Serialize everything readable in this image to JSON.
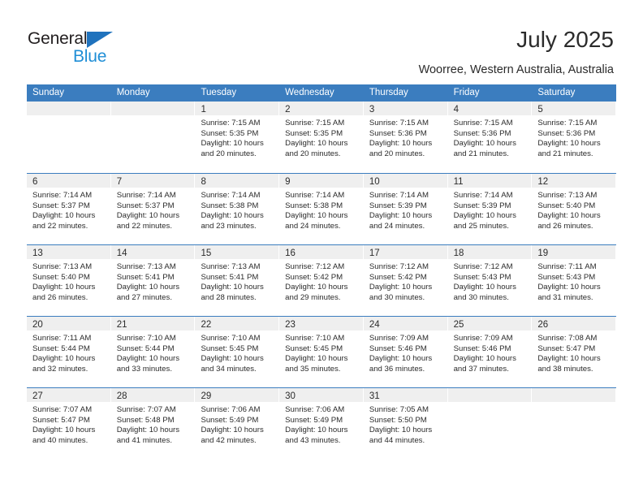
{
  "logo": {
    "primary_text": "General",
    "secondary_text": "Blue",
    "triangle_color": "#1f72bd",
    "primary_color": "#231f20",
    "secondary_color": "#1f8ed6"
  },
  "header": {
    "title": "July 2025",
    "subtitle": "Woorree, Western Australia, Australia"
  },
  "calendar": {
    "header_bg": "#3b7dbf",
    "daynum_bg": "#efefef",
    "weekdays": [
      "Sunday",
      "Monday",
      "Tuesday",
      "Wednesday",
      "Thursday",
      "Friday",
      "Saturday"
    ],
    "weeks": [
      [
        {
          "day": "",
          "sunrise": "",
          "sunset": "",
          "daylight": "",
          "empty": true
        },
        {
          "day": "",
          "sunrise": "",
          "sunset": "",
          "daylight": "",
          "empty": true
        },
        {
          "day": "1",
          "sunrise": "Sunrise: 7:15 AM",
          "sunset": "Sunset: 5:35 PM",
          "daylight": "Daylight: 10 hours and 20 minutes."
        },
        {
          "day": "2",
          "sunrise": "Sunrise: 7:15 AM",
          "sunset": "Sunset: 5:35 PM",
          "daylight": "Daylight: 10 hours and 20 minutes."
        },
        {
          "day": "3",
          "sunrise": "Sunrise: 7:15 AM",
          "sunset": "Sunset: 5:36 PM",
          "daylight": "Daylight: 10 hours and 20 minutes."
        },
        {
          "day": "4",
          "sunrise": "Sunrise: 7:15 AM",
          "sunset": "Sunset: 5:36 PM",
          "daylight": "Daylight: 10 hours and 21 minutes."
        },
        {
          "day": "5",
          "sunrise": "Sunrise: 7:15 AM",
          "sunset": "Sunset: 5:36 PM",
          "daylight": "Daylight: 10 hours and 21 minutes."
        }
      ],
      [
        {
          "day": "6",
          "sunrise": "Sunrise: 7:14 AM",
          "sunset": "Sunset: 5:37 PM",
          "daylight": "Daylight: 10 hours and 22 minutes."
        },
        {
          "day": "7",
          "sunrise": "Sunrise: 7:14 AM",
          "sunset": "Sunset: 5:37 PM",
          "daylight": "Daylight: 10 hours and 22 minutes."
        },
        {
          "day": "8",
          "sunrise": "Sunrise: 7:14 AM",
          "sunset": "Sunset: 5:38 PM",
          "daylight": "Daylight: 10 hours and 23 minutes."
        },
        {
          "day": "9",
          "sunrise": "Sunrise: 7:14 AM",
          "sunset": "Sunset: 5:38 PM",
          "daylight": "Daylight: 10 hours and 24 minutes."
        },
        {
          "day": "10",
          "sunrise": "Sunrise: 7:14 AM",
          "sunset": "Sunset: 5:39 PM",
          "daylight": "Daylight: 10 hours and 24 minutes."
        },
        {
          "day": "11",
          "sunrise": "Sunrise: 7:14 AM",
          "sunset": "Sunset: 5:39 PM",
          "daylight": "Daylight: 10 hours and 25 minutes."
        },
        {
          "day": "12",
          "sunrise": "Sunrise: 7:13 AM",
          "sunset": "Sunset: 5:40 PM",
          "daylight": "Daylight: 10 hours and 26 minutes."
        }
      ],
      [
        {
          "day": "13",
          "sunrise": "Sunrise: 7:13 AM",
          "sunset": "Sunset: 5:40 PM",
          "daylight": "Daylight: 10 hours and 26 minutes."
        },
        {
          "day": "14",
          "sunrise": "Sunrise: 7:13 AM",
          "sunset": "Sunset: 5:41 PM",
          "daylight": "Daylight: 10 hours and 27 minutes."
        },
        {
          "day": "15",
          "sunrise": "Sunrise: 7:13 AM",
          "sunset": "Sunset: 5:41 PM",
          "daylight": "Daylight: 10 hours and 28 minutes."
        },
        {
          "day": "16",
          "sunrise": "Sunrise: 7:12 AM",
          "sunset": "Sunset: 5:42 PM",
          "daylight": "Daylight: 10 hours and 29 minutes."
        },
        {
          "day": "17",
          "sunrise": "Sunrise: 7:12 AM",
          "sunset": "Sunset: 5:42 PM",
          "daylight": "Daylight: 10 hours and 30 minutes."
        },
        {
          "day": "18",
          "sunrise": "Sunrise: 7:12 AM",
          "sunset": "Sunset: 5:43 PM",
          "daylight": "Daylight: 10 hours and 30 minutes."
        },
        {
          "day": "19",
          "sunrise": "Sunrise: 7:11 AM",
          "sunset": "Sunset: 5:43 PM",
          "daylight": "Daylight: 10 hours and 31 minutes."
        }
      ],
      [
        {
          "day": "20",
          "sunrise": "Sunrise: 7:11 AM",
          "sunset": "Sunset: 5:44 PM",
          "daylight": "Daylight: 10 hours and 32 minutes."
        },
        {
          "day": "21",
          "sunrise": "Sunrise: 7:10 AM",
          "sunset": "Sunset: 5:44 PM",
          "daylight": "Daylight: 10 hours and 33 minutes."
        },
        {
          "day": "22",
          "sunrise": "Sunrise: 7:10 AM",
          "sunset": "Sunset: 5:45 PM",
          "daylight": "Daylight: 10 hours and 34 minutes."
        },
        {
          "day": "23",
          "sunrise": "Sunrise: 7:10 AM",
          "sunset": "Sunset: 5:45 PM",
          "daylight": "Daylight: 10 hours and 35 minutes."
        },
        {
          "day": "24",
          "sunrise": "Sunrise: 7:09 AM",
          "sunset": "Sunset: 5:46 PM",
          "daylight": "Daylight: 10 hours and 36 minutes."
        },
        {
          "day": "25",
          "sunrise": "Sunrise: 7:09 AM",
          "sunset": "Sunset: 5:46 PM",
          "daylight": "Daylight: 10 hours and 37 minutes."
        },
        {
          "day": "26",
          "sunrise": "Sunrise: 7:08 AM",
          "sunset": "Sunset: 5:47 PM",
          "daylight": "Daylight: 10 hours and 38 minutes."
        }
      ],
      [
        {
          "day": "27",
          "sunrise": "Sunrise: 7:07 AM",
          "sunset": "Sunset: 5:47 PM",
          "daylight": "Daylight: 10 hours and 40 minutes."
        },
        {
          "day": "28",
          "sunrise": "Sunrise: 7:07 AM",
          "sunset": "Sunset: 5:48 PM",
          "daylight": "Daylight: 10 hours and 41 minutes."
        },
        {
          "day": "29",
          "sunrise": "Sunrise: 7:06 AM",
          "sunset": "Sunset: 5:49 PM",
          "daylight": "Daylight: 10 hours and 42 minutes."
        },
        {
          "day": "30",
          "sunrise": "Sunrise: 7:06 AM",
          "sunset": "Sunset: 5:49 PM",
          "daylight": "Daylight: 10 hours and 43 minutes."
        },
        {
          "day": "31",
          "sunrise": "Sunrise: 7:05 AM",
          "sunset": "Sunset: 5:50 PM",
          "daylight": "Daylight: 10 hours and 44 minutes."
        },
        {
          "day": "",
          "sunrise": "",
          "sunset": "",
          "daylight": "",
          "empty": true
        },
        {
          "day": "",
          "sunrise": "",
          "sunset": "",
          "daylight": "",
          "empty": true
        }
      ]
    ]
  }
}
